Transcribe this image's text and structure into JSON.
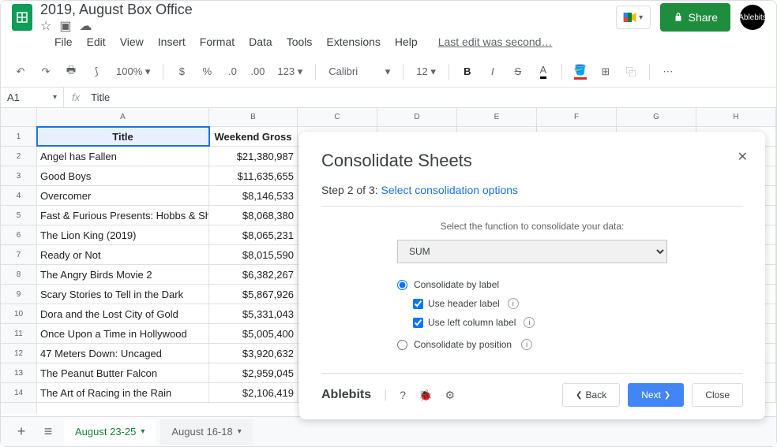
{
  "doc": {
    "title": "2019, August Box Office",
    "last_edit": "Last edit was second…"
  },
  "menus": {
    "file": "File",
    "edit": "Edit",
    "view": "View",
    "insert": "Insert",
    "format": "Format",
    "data": "Data",
    "tools": "Tools",
    "extensions": "Extensions",
    "help": "Help"
  },
  "share": {
    "label": "Share"
  },
  "avatar": {
    "label": "Ablebits"
  },
  "toolbar": {
    "zoom": "100%",
    "format_123": "123",
    "font": "Calibri",
    "size": "12",
    "bold": "B",
    "italic": "I",
    "strike": "S",
    "textcolor": "A",
    "more": "⋯"
  },
  "formula": {
    "ref": "A1",
    "fx": "fx",
    "value": "Title"
  },
  "columns": [
    "A",
    "B",
    "C",
    "D",
    "E",
    "F",
    "G",
    "H"
  ],
  "header_row": {
    "title": "Title",
    "gross": "Weekend Gross"
  },
  "rows": [
    {
      "n": "1"
    },
    {
      "n": "2",
      "title": "Angel has Fallen",
      "gross": "$21,380,987"
    },
    {
      "n": "3",
      "title": "Good Boys",
      "gross": "$11,635,655"
    },
    {
      "n": "4",
      "title": "Overcomer",
      "gross": "$8,146,533"
    },
    {
      "n": "5",
      "title": "Fast & Furious Presents: Hobbs & Shaw",
      "gross": "$8,068,380"
    },
    {
      "n": "6",
      "title": "The Lion King (2019)",
      "gross": "$8,065,231"
    },
    {
      "n": "7",
      "title": "Ready or Not",
      "gross": "$8,015,590"
    },
    {
      "n": "8",
      "title": "The Angry Birds Movie 2",
      "gross": "$6,382,267"
    },
    {
      "n": "9",
      "title": "Scary Stories to Tell in the Dark",
      "gross": "$5,867,926"
    },
    {
      "n": "10",
      "title": "Dora and the Lost City of Gold",
      "gross": "$5,331,043"
    },
    {
      "n": "11",
      "title": "Once Upon a Time in Hollywood",
      "gross": "$5,005,400"
    },
    {
      "n": "12",
      "title": "47 Meters Down: Uncaged",
      "gross": "$3,920,632"
    },
    {
      "n": "13",
      "title": "The Peanut Butter Falcon",
      "gross": "$2,959,045"
    },
    {
      "n": "14",
      "title": "The Art of Racing in the Rain",
      "gross": "$2,106,419"
    }
  ],
  "tabs": {
    "active": "August 23-25",
    "inactive": "August 16-18"
  },
  "panel": {
    "title": "Consolidate Sheets",
    "step_prefix": "Step 2 of 3: ",
    "step_link": "Select consolidation options",
    "func_label": "Select the function to consolidate your data:",
    "func_value": "SUM",
    "opt_label": "Consolidate by label",
    "chk_header": "Use header label",
    "chk_leftcol": "Use left column label",
    "opt_position": "Consolidate by position",
    "brand": "Ablebits",
    "back": "Back",
    "next": "Next",
    "close": "Close"
  }
}
